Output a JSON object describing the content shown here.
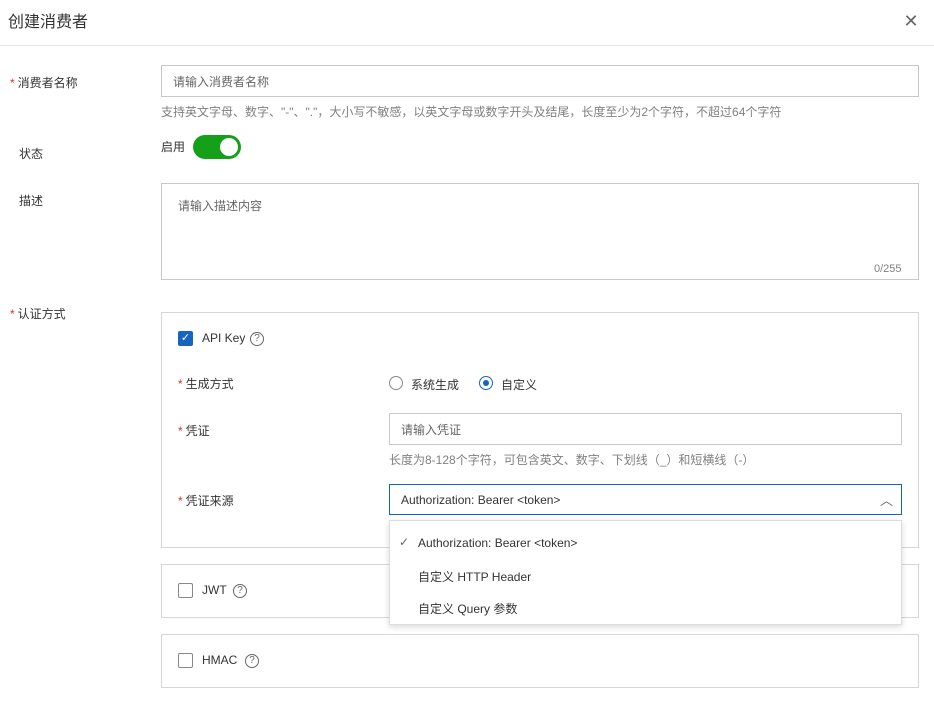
{
  "dialog": {
    "title": "创建消费者",
    "close_icon": "close-icon"
  },
  "form": {
    "name": {
      "label": "消费者名称",
      "required": "*",
      "placeholder": "请输入消费者名称",
      "hint": "支持英文字母、数字、\"-\"、\".\"，大小写不敏感，以英文字母或数字开头及结尾，长度至少为2个字符，不超过64个字符"
    },
    "status": {
      "label": "状态",
      "toggle_label": "启用",
      "enabled": true
    },
    "description": {
      "label": "描述",
      "placeholder": "请输入描述内容",
      "counter": "0/255"
    },
    "auth": {
      "label": "认证方式",
      "required": "*",
      "api_key": {
        "label": "API Key",
        "checked": true,
        "help": "?",
        "gen_method": {
          "label": "生成方式",
          "options": [
            "系统生成",
            "自定义"
          ],
          "selected": "自定义"
        },
        "credential": {
          "label": "凭证",
          "placeholder": "请输入凭证",
          "hint": "长度为8-128个字符，可包含英文、数字、下划线（_）和短横线（-）"
        },
        "source": {
          "label": "凭证来源",
          "value": "Authorization: Bearer <token>",
          "options": [
            "Authorization: Bearer <token>",
            "自定义 HTTP Header",
            "自定义 Query 参数"
          ]
        }
      },
      "jwt": {
        "label": "JWT",
        "checked": false,
        "help": "?"
      },
      "hmac": {
        "label": "HMAC",
        "checked": false,
        "help": "?"
      }
    }
  },
  "colors": {
    "primary": "#1565c0",
    "toggle_on": "#15a01a",
    "required": "#e0301e"
  }
}
